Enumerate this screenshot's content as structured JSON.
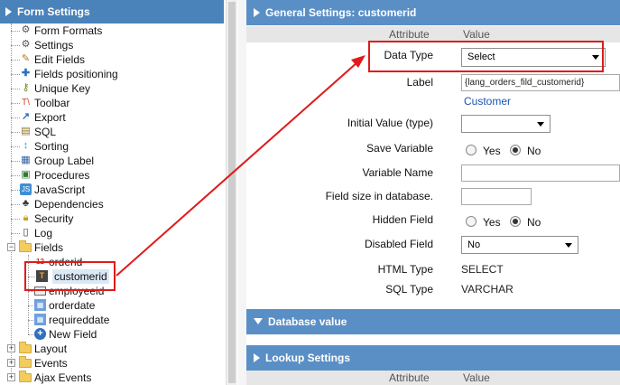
{
  "left_panel": {
    "title": "Form Settings",
    "items": [
      {
        "label": "Form Formats",
        "icon": "gear-icon"
      },
      {
        "label": "Settings",
        "icon": "gear-icon"
      },
      {
        "label": "Edit Fields",
        "icon": "pencil-icon"
      },
      {
        "label": "Fields positioning",
        "icon": "move-icon"
      },
      {
        "label": "Unique Key",
        "icon": "key-icon"
      },
      {
        "label": "Toolbar",
        "icon": "toolbar-icon"
      },
      {
        "label": "Export",
        "icon": "export-icon"
      },
      {
        "label": "SQL",
        "icon": "database-icon"
      },
      {
        "label": "Sorting",
        "icon": "sort-icon"
      },
      {
        "label": "Group Label",
        "icon": "group-label-icon"
      },
      {
        "label": "Procedures",
        "icon": "procedures-icon"
      },
      {
        "label": "JavaScript",
        "icon": "javascript-icon"
      },
      {
        "label": "Dependencies",
        "icon": "dependencies-icon"
      },
      {
        "label": "Security",
        "icon": "lock-icon"
      },
      {
        "label": "Log",
        "icon": "log-icon"
      }
    ],
    "fields_folder": "Fields",
    "fields": [
      {
        "label": "orderid",
        "icon_text": "12"
      },
      {
        "label": "customerid",
        "icon_text": "T"
      },
      {
        "label": "employeeid",
        "icon_text": ""
      },
      {
        "label": "orderdate",
        "icon_text": ""
      },
      {
        "label": "requireddate",
        "icon_text": ""
      },
      {
        "label": "New Field",
        "icon_text": "+"
      }
    ],
    "bottom_folders": [
      "Layout",
      "Events",
      "Ajax Events"
    ]
  },
  "right_panel": {
    "title": "General Settings: customerid",
    "col_attribute": "Attribute",
    "col_value": "Value",
    "rows": {
      "data_type_label": "Data Type",
      "data_type_value": "Select",
      "label_label": "Label",
      "label_value": "{lang_orders_fild_customerid}",
      "label_preview": "Customer",
      "initial_value_label": "Initial Value (type)",
      "initial_value_value": "",
      "save_variable_label": "Save Variable",
      "yes": "Yes",
      "no": "No",
      "variable_name_label": "Variable Name",
      "variable_name_value": "",
      "field_size_label": "Field size in database.",
      "field_size_value": "",
      "hidden_field_label": "Hidden Field",
      "disabled_field_label": "Disabled Field",
      "disabled_field_value": "No",
      "html_type_label": "HTML Type",
      "html_type_value": "SELECT",
      "sql_type_label": "SQL Type",
      "sql_type_value": "VARCHAR"
    },
    "database_value_section": "Database value",
    "lookup_settings_section": "Lookup Settings",
    "lookup_col_attribute": "Attribute",
    "lookup_col_value": "Value"
  },
  "colors": {
    "header_blue": "#4a82ba",
    "section_blue": "#5a8fc6",
    "highlight_red": "#e01b1b",
    "link_blue": "#1a55b5"
  }
}
